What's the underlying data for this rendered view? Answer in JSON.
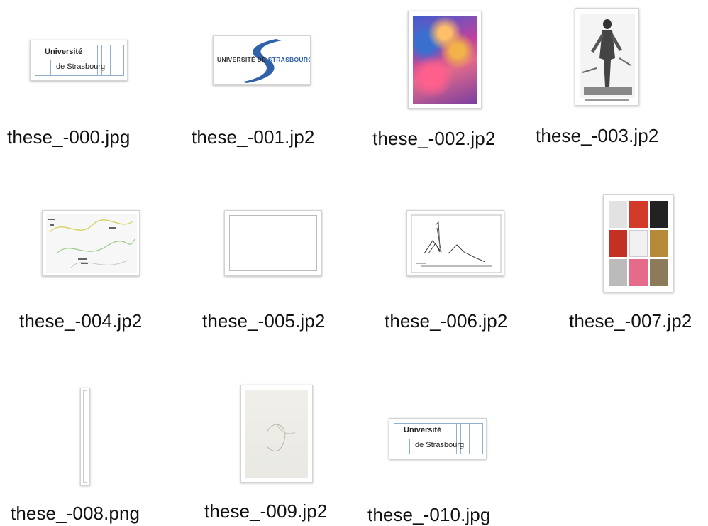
{
  "files": [
    {
      "name": "these_-000.jpg",
      "thumb": "university-logo-icon"
    },
    {
      "name": "these_-001.jp2",
      "thumb": "strasbourg-banner-icon"
    },
    {
      "name": "these_-002.jp2",
      "thumb": "painting-icon"
    },
    {
      "name": "these_-003.jp2",
      "thumb": "anatomy-engraving-icon"
    },
    {
      "name": "these_-004.jp2",
      "thumb": "map-icon"
    },
    {
      "name": "these_-005.jp2",
      "thumb": "blank-page-icon"
    },
    {
      "name": "these_-006.jp2",
      "thumb": "sketch-drawing-icon"
    },
    {
      "name": "these_-007.jp2",
      "thumb": "book-covers-grid-icon"
    },
    {
      "name": "these_-008.png",
      "thumb": "narrow-strip-icon"
    },
    {
      "name": "these_-009.jp2",
      "thumb": "pencil-sketch-icon"
    },
    {
      "name": "these_-010.jpg",
      "thumb": "university-logo-icon"
    }
  ],
  "logo": {
    "line1": "Université",
    "line2": "de Strasbourg"
  },
  "banner": {
    "part1": "UNIVERSITÉ DE ",
    "part2": "STRASBOURG"
  },
  "colors": {
    "logo_blue": "#8fb0cf",
    "banner_blue": "#2f62a8"
  }
}
